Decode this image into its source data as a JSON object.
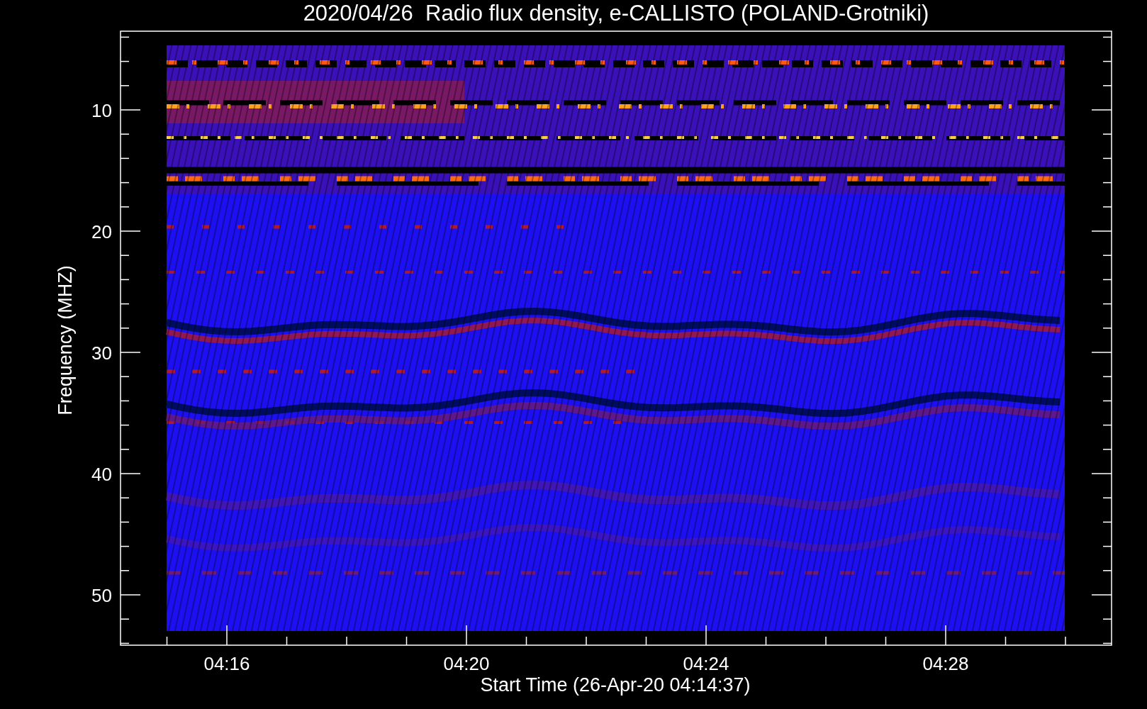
{
  "title": "2020/04/26  Radio flux density, e-CALLISTO (POLAND-Grotniki)",
  "y_axis": {
    "label": "Frequency (MHZ)",
    "ticks": [
      "10",
      "20",
      "30",
      "40",
      "50"
    ]
  },
  "x_axis": {
    "label": "Start Time (26-Apr-20 04:14:37)",
    "ticks": [
      "04:16",
      "04:20",
      "04:24",
      "04:28"
    ]
  }
}
